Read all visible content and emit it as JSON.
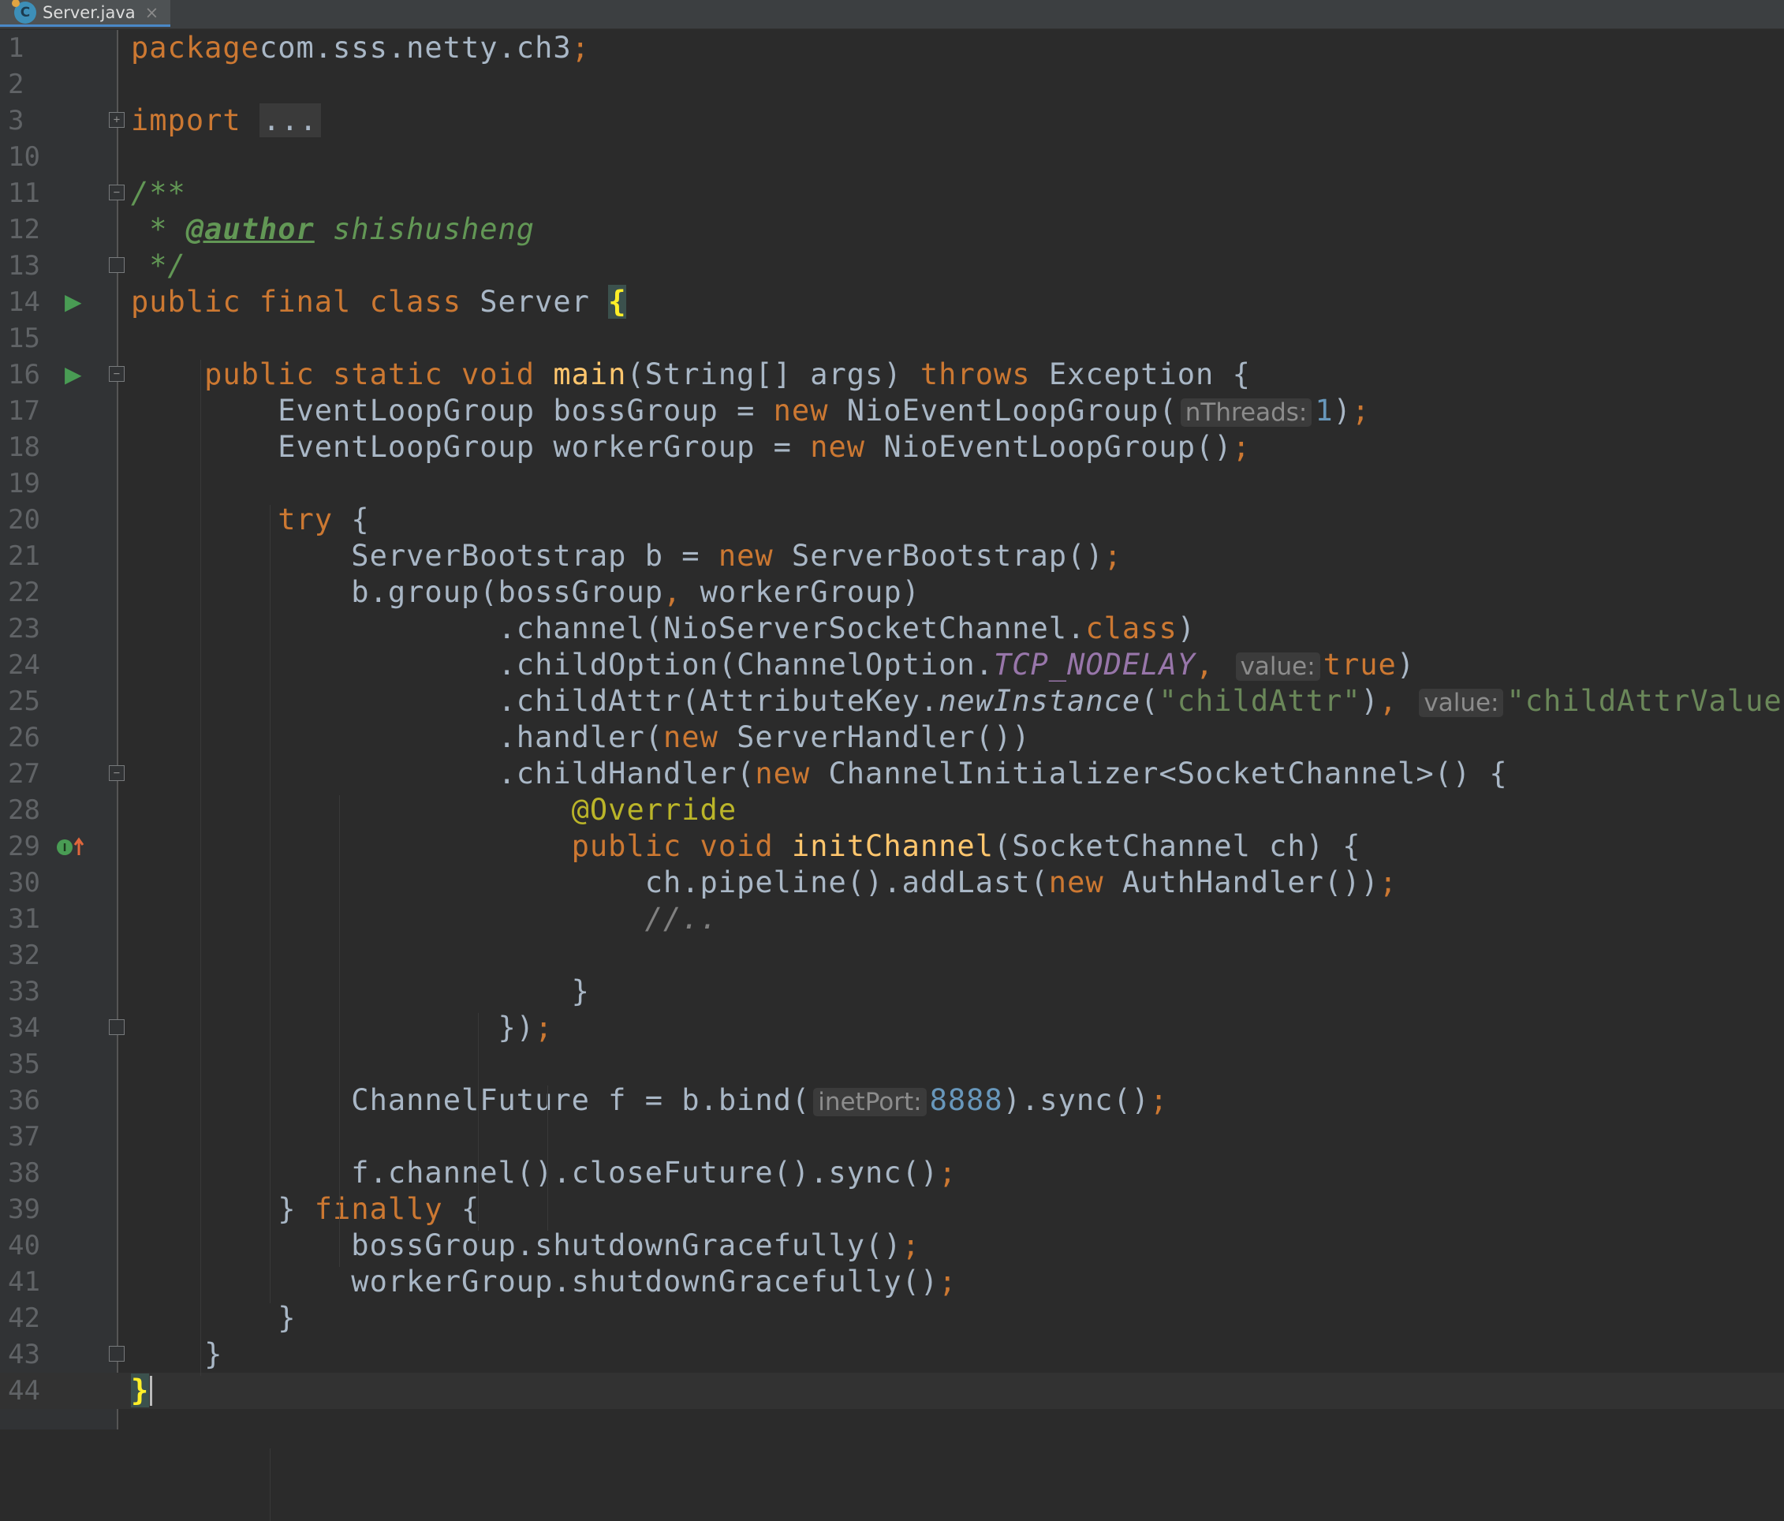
{
  "tab": {
    "filename": "Server.java",
    "icon": "java-class-icon",
    "close": "×"
  },
  "lines": [
    {
      "n": "1",
      "tokens": [
        [
          "kw",
          "package"
        ],
        [
          "",
          "com.sss.netty.ch3"
        ],
        [
          "kw",
          ";"
        ]
      ]
    },
    {
      "n": "2",
      "tokens": []
    },
    {
      "n": "3",
      "fold": "+",
      "tokens": [
        [
          "kw",
          "import"
        ],
        [
          "",
          " "
        ],
        [
          "folded",
          "..."
        ]
      ]
    },
    {
      "n": "10",
      "tokens": []
    },
    {
      "n": "11",
      "fold": "-",
      "tokens": [
        [
          "doc",
          "/**"
        ]
      ]
    },
    {
      "n": "12",
      "tokens": [
        [
          "doc",
          " * "
        ],
        [
          "doctag",
          "@author"
        ],
        [
          "doc",
          " shishusheng"
        ]
      ]
    },
    {
      "n": "13",
      "fold": "end",
      "tokens": [
        [
          "doc",
          " */"
        ]
      ]
    },
    {
      "n": "14",
      "run": true,
      "tokens": [
        [
          "kw",
          "public final class"
        ],
        [
          "",
          " Server "
        ],
        [
          "brace-match",
          "{"
        ]
      ]
    },
    {
      "n": "15",
      "tokens": []
    },
    {
      "n": "16",
      "run": true,
      "fold": "-",
      "tokens": [
        [
          "",
          "    "
        ],
        [
          "kw",
          "public static void"
        ],
        [
          "",
          " "
        ],
        [
          "fn",
          "main"
        ],
        [
          "",
          "(String[] args) "
        ],
        [
          "kw",
          "throws"
        ],
        [
          "",
          " Exception {"
        ]
      ]
    },
    {
      "n": "17",
      "tokens": [
        [
          "",
          "        EventLoopGroup bossGroup = "
        ],
        [
          "kw",
          "new"
        ],
        [
          "",
          " NioEventLoopGroup("
        ],
        [
          "hint",
          "nThreads:"
        ],
        [
          "num",
          "1"
        ],
        [
          "",
          ")"
        ],
        [
          "kw",
          ";"
        ]
      ]
    },
    {
      "n": "18",
      "tokens": [
        [
          "",
          "        EventLoopGroup workerGroup = "
        ],
        [
          "kw",
          "new"
        ],
        [
          "",
          " NioEventLoopGroup()"
        ],
        [
          "kw",
          ";"
        ]
      ]
    },
    {
      "n": "19",
      "tokens": []
    },
    {
      "n": "20",
      "tokens": [
        [
          "",
          "        "
        ],
        [
          "kw",
          "try"
        ],
        [
          "",
          " {"
        ]
      ]
    },
    {
      "n": "21",
      "tokens": [
        [
          "",
          "            ServerBootstrap b = "
        ],
        [
          "kw",
          "new"
        ],
        [
          "",
          " ServerBootstrap()"
        ],
        [
          "kw",
          ";"
        ]
      ]
    },
    {
      "n": "22",
      "tokens": [
        [
          "",
          "            b.group(bossGroup"
        ],
        [
          "kw",
          ","
        ],
        [
          "",
          " workerGroup)"
        ]
      ]
    },
    {
      "n": "23",
      "tokens": [
        [
          "",
          "                    .channel(NioServerSocketChannel."
        ],
        [
          "kw",
          "class"
        ],
        [
          "",
          ")"
        ]
      ]
    },
    {
      "n": "24",
      "tokens": [
        [
          "",
          "                    .childOption(ChannelOption."
        ],
        [
          "static",
          "TCP_NODELAY"
        ],
        [
          "kw",
          ","
        ],
        [
          "",
          " "
        ],
        [
          "hint",
          "value:"
        ],
        [
          "kw",
          "true"
        ],
        [
          "",
          ")"
        ]
      ]
    },
    {
      "n": "25",
      "tokens": [
        [
          "",
          "                    .childAttr(AttributeKey."
        ],
        [
          "it",
          "newInstance"
        ],
        [
          "",
          "("
        ],
        [
          "str",
          "\"childAttr\""
        ],
        [
          "",
          ")"
        ],
        [
          "kw",
          ","
        ],
        [
          "",
          " "
        ],
        [
          "hint",
          "value:"
        ],
        [
          "str",
          "\"childAttrValue\""
        ],
        [
          "",
          ")"
        ]
      ]
    },
    {
      "n": "26",
      "tokens": [
        [
          "",
          "                    .handler("
        ],
        [
          "kw",
          "new"
        ],
        [
          "",
          " ServerHandler())"
        ]
      ]
    },
    {
      "n": "27",
      "fold": "-",
      "tokens": [
        [
          "",
          "                    .childHandler("
        ],
        [
          "kw",
          "new"
        ],
        [
          "",
          " ChannelInitializer<SocketChannel>() {"
        ]
      ]
    },
    {
      "n": "28",
      "tokens": [
        [
          "",
          "                        "
        ],
        [
          "ann",
          "@Override"
        ]
      ]
    },
    {
      "n": "29",
      "impl": true,
      "tokens": [
        [
          "",
          "                        "
        ],
        [
          "kw",
          "public void"
        ],
        [
          "",
          " "
        ],
        [
          "fn",
          "initChannel"
        ],
        [
          "",
          "(SocketChannel ch) {"
        ]
      ]
    },
    {
      "n": "30",
      "tokens": [
        [
          "",
          "                            ch.pipeline().addLast("
        ],
        [
          "kw",
          "new"
        ],
        [
          "",
          " AuthHandler())"
        ],
        [
          "kw",
          ";"
        ]
      ]
    },
    {
      "n": "31",
      "tokens": [
        [
          "",
          "                            "
        ],
        [
          "cmt",
          "//.."
        ]
      ]
    },
    {
      "n": "32",
      "tokens": []
    },
    {
      "n": "33",
      "tokens": [
        [
          "",
          "                        }"
        ]
      ]
    },
    {
      "n": "34",
      "fold": "end",
      "tokens": [
        [
          "",
          "                    })"
        ],
        [
          "kw",
          ";"
        ]
      ]
    },
    {
      "n": "35",
      "tokens": []
    },
    {
      "n": "36",
      "tokens": [
        [
          "",
          "            ChannelFuture f = b.bind("
        ],
        [
          "hint",
          "inetPort:"
        ],
        [
          "num",
          "8888"
        ],
        [
          "",
          ").sync()"
        ],
        [
          "kw",
          ";"
        ]
      ]
    },
    {
      "n": "37",
      "tokens": []
    },
    {
      "n": "38",
      "tokens": [
        [
          "",
          "            f.channel().closeFuture().sync()"
        ],
        [
          "kw",
          ";"
        ]
      ]
    },
    {
      "n": "39",
      "tokens": [
        [
          "",
          "        } "
        ],
        [
          "kw",
          "finally"
        ],
        [
          "",
          " {"
        ]
      ]
    },
    {
      "n": "40",
      "tokens": [
        [
          "",
          "            bossGroup.shutdownGracefully()"
        ],
        [
          "kw",
          ";"
        ]
      ]
    },
    {
      "n": "41",
      "tokens": [
        [
          "",
          "            workerGroup.shutdownGracefully()"
        ],
        [
          "kw",
          ";"
        ]
      ]
    },
    {
      "n": "42",
      "tokens": [
        [
          "",
          "        }"
        ]
      ]
    },
    {
      "n": "43",
      "fold": "end",
      "tokens": [
        [
          "",
          "    }"
        ]
      ]
    },
    {
      "n": "44",
      "current": true,
      "tokens": [
        [
          "brace-match",
          "}"
        ]
      ]
    }
  ]
}
